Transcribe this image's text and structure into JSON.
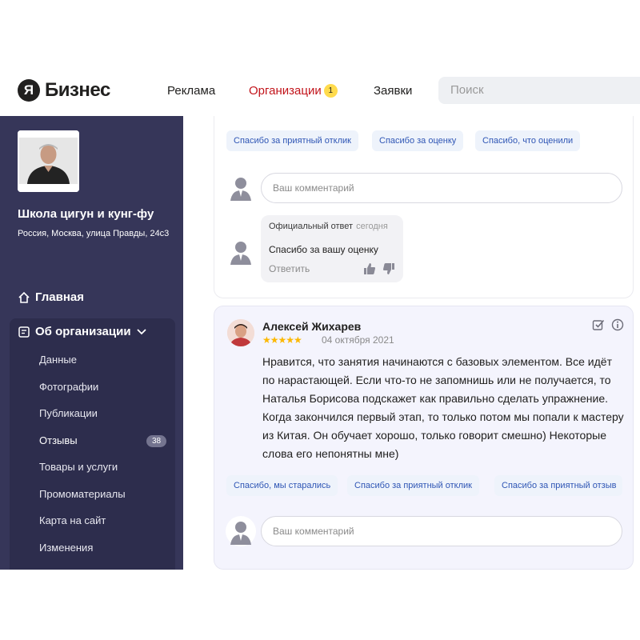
{
  "header": {
    "logo_mark": "Я",
    "logo_text": "Бизнес",
    "nav": {
      "ads": "Реклама",
      "organizations": "Организации",
      "organizations_badge": "1",
      "requests": "Заявки"
    },
    "search_placeholder": "Поиск"
  },
  "sidebar": {
    "org_name": "Школа цигун и кунг-фу",
    "org_address": "Россия, Москва, улица Правды, 24с3",
    "main_label": "Главная",
    "group_label": "Об организации",
    "items": [
      {
        "label": "Данные"
      },
      {
        "label": "Фотографии"
      },
      {
        "label": "Публикации"
      },
      {
        "label": "Отзывы",
        "badge": "38"
      },
      {
        "label": "Товары и услуги"
      },
      {
        "label": "Промоматериалы"
      },
      {
        "label": "Карта на сайт"
      },
      {
        "label": "Изменения"
      }
    ]
  },
  "review1": {
    "chips": [
      "Спасибо за приятный отклик",
      "Спасибо за оценку",
      "Спасибо, что оценили"
    ],
    "comment_placeholder": "Ваш комментарий",
    "reply": {
      "label": "Официальный ответ",
      "date": "сегодня",
      "text": "Спасибо за вашу оценку",
      "action": "Ответить"
    }
  },
  "review2": {
    "author": "Алексей Жихарев",
    "rating": 5,
    "stars": "★★★★★",
    "date": "04 октября 2021",
    "text": "Нравится, что занятия начинаются с базовых элементом. Все идёт по нарастающей. Если что-то не запомнишь или не получается, то Наталья Борисова подскажет как правильно сделать упражнение. Когда закончился первый этап, то только потом мы попали к мастеру из Китая. Он обучает хорошо, только говорит смешно) Некоторые слова его непонятны мне)",
    "chips": [
      "Спасибо, мы старались",
      "Спасибо за приятный отклик",
      "Спасибо за приятный отзыв"
    ],
    "comment_placeholder": "Ваш комментарий"
  },
  "colors": {
    "sidebar_bg": "#363659",
    "active_nav": "#c2141b",
    "chip_text": "#2f56b5",
    "star": "#fcb800"
  }
}
